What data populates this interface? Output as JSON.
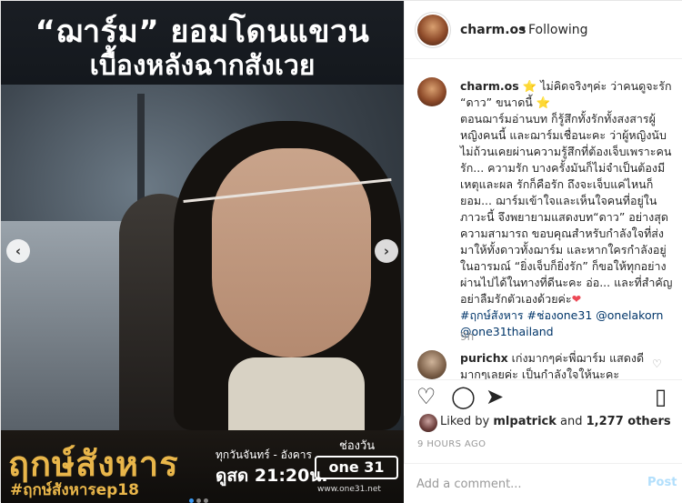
{
  "media": {
    "headline_line1": "“ฌาร์ม” ยอมโดนแขวน",
    "headline_line2": "เบื้องหลังฉากสังเวย",
    "show_title": "ฤกษ์สังหาร",
    "hashtag": "#ฤกษ์สังหารep18",
    "airtime_days": "ทุกวันจันทร์ - อังคาร",
    "airtime_time": "ดูสด 21:20น.",
    "channel_label": "ช่องวัน",
    "channel_logo": "one 31",
    "channel_url": "www.one31.net",
    "prev_arrow": "‹",
    "next_arrow": "›",
    "carousel_dots": 3,
    "carousel_active": 0
  },
  "header": {
    "username": "charm.os",
    "separator": "•",
    "follow_status": "Following"
  },
  "caption": {
    "username": "charm.os",
    "star": "⭐",
    "line_head": " ไม่คิดจริงๆค่ะ ว่าคนดูจะรัก “ดาว” ขนาดนี้",
    "body": "ตอนฌาร์มอ่านบท ก็รู้สึกทั้งรักทั้งสงสารผู้หญิงคนนี้ และฌาร์มเชื่อนะคะ ว่าผู้หญิงนับไม่ถ้วนเคยผ่านความรู้สึกที่ต้องเจ็บเพราะคนรัก... ความรัก บางครั้งมันก็ไม่จำเป็นต้องมีเหตุและผล รักก็คือรัก ถึงจะเจ็บแค่ไหนก็ยอม... ฌาร์มเข้าใจและเห็นใจคนที่อยู่ในภาวะนี้ จึงพยายามแสดงบท“ดาว” อย่างสุดความสามารถ ขอบคุณสำหรับกำลังใจที่ส่งมาให้ทั้งดาวทั้งฌาร์ม และหากใครกำลังอยู่ในอารมณ์ “ยิ่งเจ็บก็ยิ่งรัก” ก็ขอให้ทุกอย่างผ่านไปได้ในทางที่ดีนะคะ อ่อ... และที่สำคัญ อย่าลืมรักตัวเองด้วยค่ะ",
    "heart": "❤",
    "tag1": "#ฤกษ์สังหาร",
    "tag2": "#ช่องone31",
    "mention1": "@onelakorn",
    "mention2": "@one31thailand",
    "time_ago": "9h"
  },
  "comment": {
    "username": "purichx",
    "text": "เก่งมากๆค่ะพี่ฌาร์ม แสดงดีมากๆเลยค่ะ เป็นกำลังใจให้นะคะ",
    "heart": "♡"
  },
  "actions": {
    "like": "♡",
    "comment": "◯",
    "share": "➤",
    "save": "▯"
  },
  "likes": {
    "prefix": "Liked by ",
    "user": "mlpatrick",
    "middle": " and ",
    "others": "1,277 others"
  },
  "timestamp": "9 HOURS AGO",
  "add_comment": {
    "placeholder": "Add a comment...",
    "post_label": "Post"
  }
}
